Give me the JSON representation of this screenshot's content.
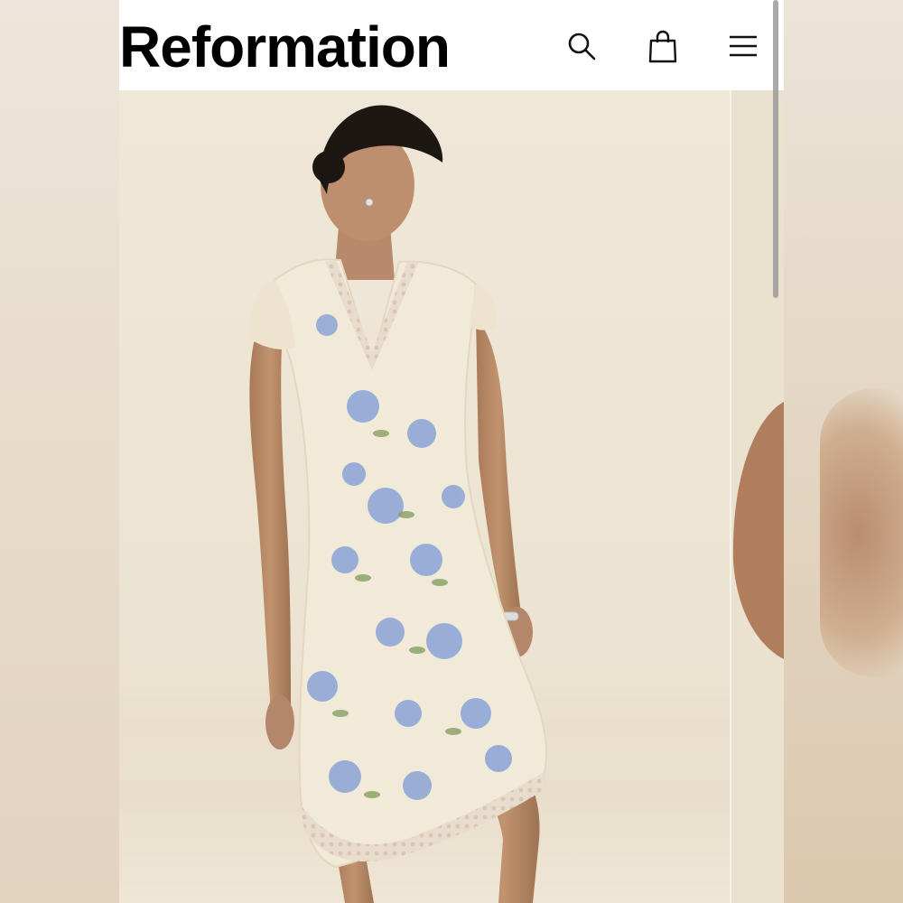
{
  "header": {
    "brand": "Reformation",
    "icons": {
      "search": "search-icon",
      "bag": "shopping-bag-icon",
      "menu": "hamburger-menu-icon"
    }
  },
  "gallery": {
    "main_image": "model-in-floral-lace-trim-dress",
    "next_image": "next-gallery-image-peek"
  },
  "colors": {
    "background": "#efe6d6",
    "header_bg": "#ffffff",
    "brand_text": "#000000",
    "dress_base": "#f2ead8",
    "flower_blue": "#8fa8d6",
    "lace": "#e4d6c6",
    "skin": "#b88a67"
  }
}
